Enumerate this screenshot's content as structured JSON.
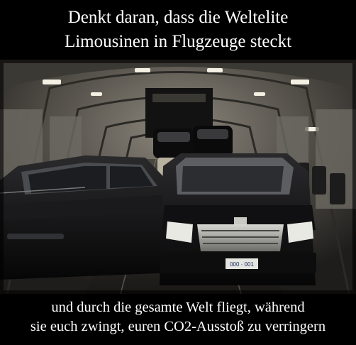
{
  "meme": {
    "top_caption": {
      "line1": "Denkt daran, dass die Weltelite",
      "line2": "Limousinen in Flugzeuge steckt"
    },
    "bottom_caption": {
      "line1": "und durch die gesamte Welt fliegt, während",
      "line2": "sie euch zwingt, euren CO2-Ausstoß zu verringern"
    },
    "photo": {
      "subject": "limousines-in-cargo-aircraft",
      "license_plate": "000 · 001"
    },
    "colors": {
      "background": "#000000",
      "caption_text": "#ffffff"
    }
  }
}
